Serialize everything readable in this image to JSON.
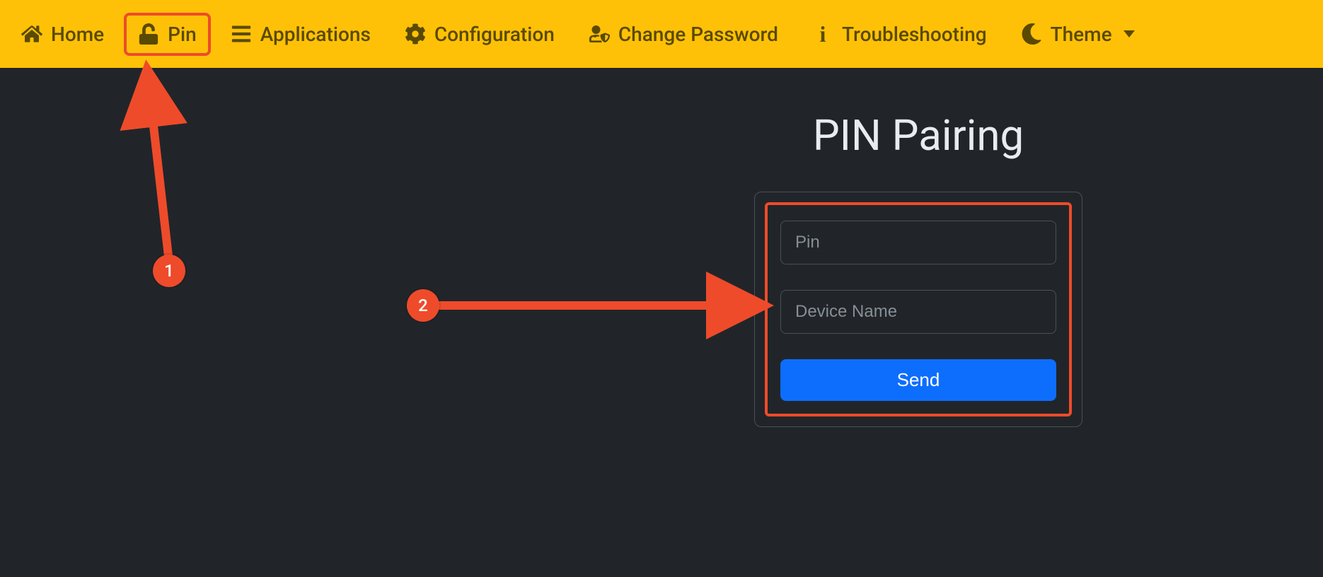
{
  "nav": {
    "home": {
      "label": "Home"
    },
    "pin": {
      "label": "Pin"
    },
    "applications": {
      "label": "Applications"
    },
    "configuration": {
      "label": "Configuration"
    },
    "change_password": {
      "label": "Change Password"
    },
    "troubleshooting": {
      "label": "Troubleshooting"
    },
    "theme": {
      "label": "Theme"
    }
  },
  "main": {
    "title": "PIN Pairing",
    "form": {
      "pin_placeholder": "Pin",
      "device_placeholder": "Device Name",
      "submit_label": "Send"
    }
  },
  "annotations": {
    "badge1": "1",
    "badge2": "2"
  },
  "colors": {
    "accent_yellow": "#ffc107",
    "highlight_red": "#ee4b2b",
    "primary_blue": "#0d6efd",
    "bg_dark": "#212529"
  }
}
